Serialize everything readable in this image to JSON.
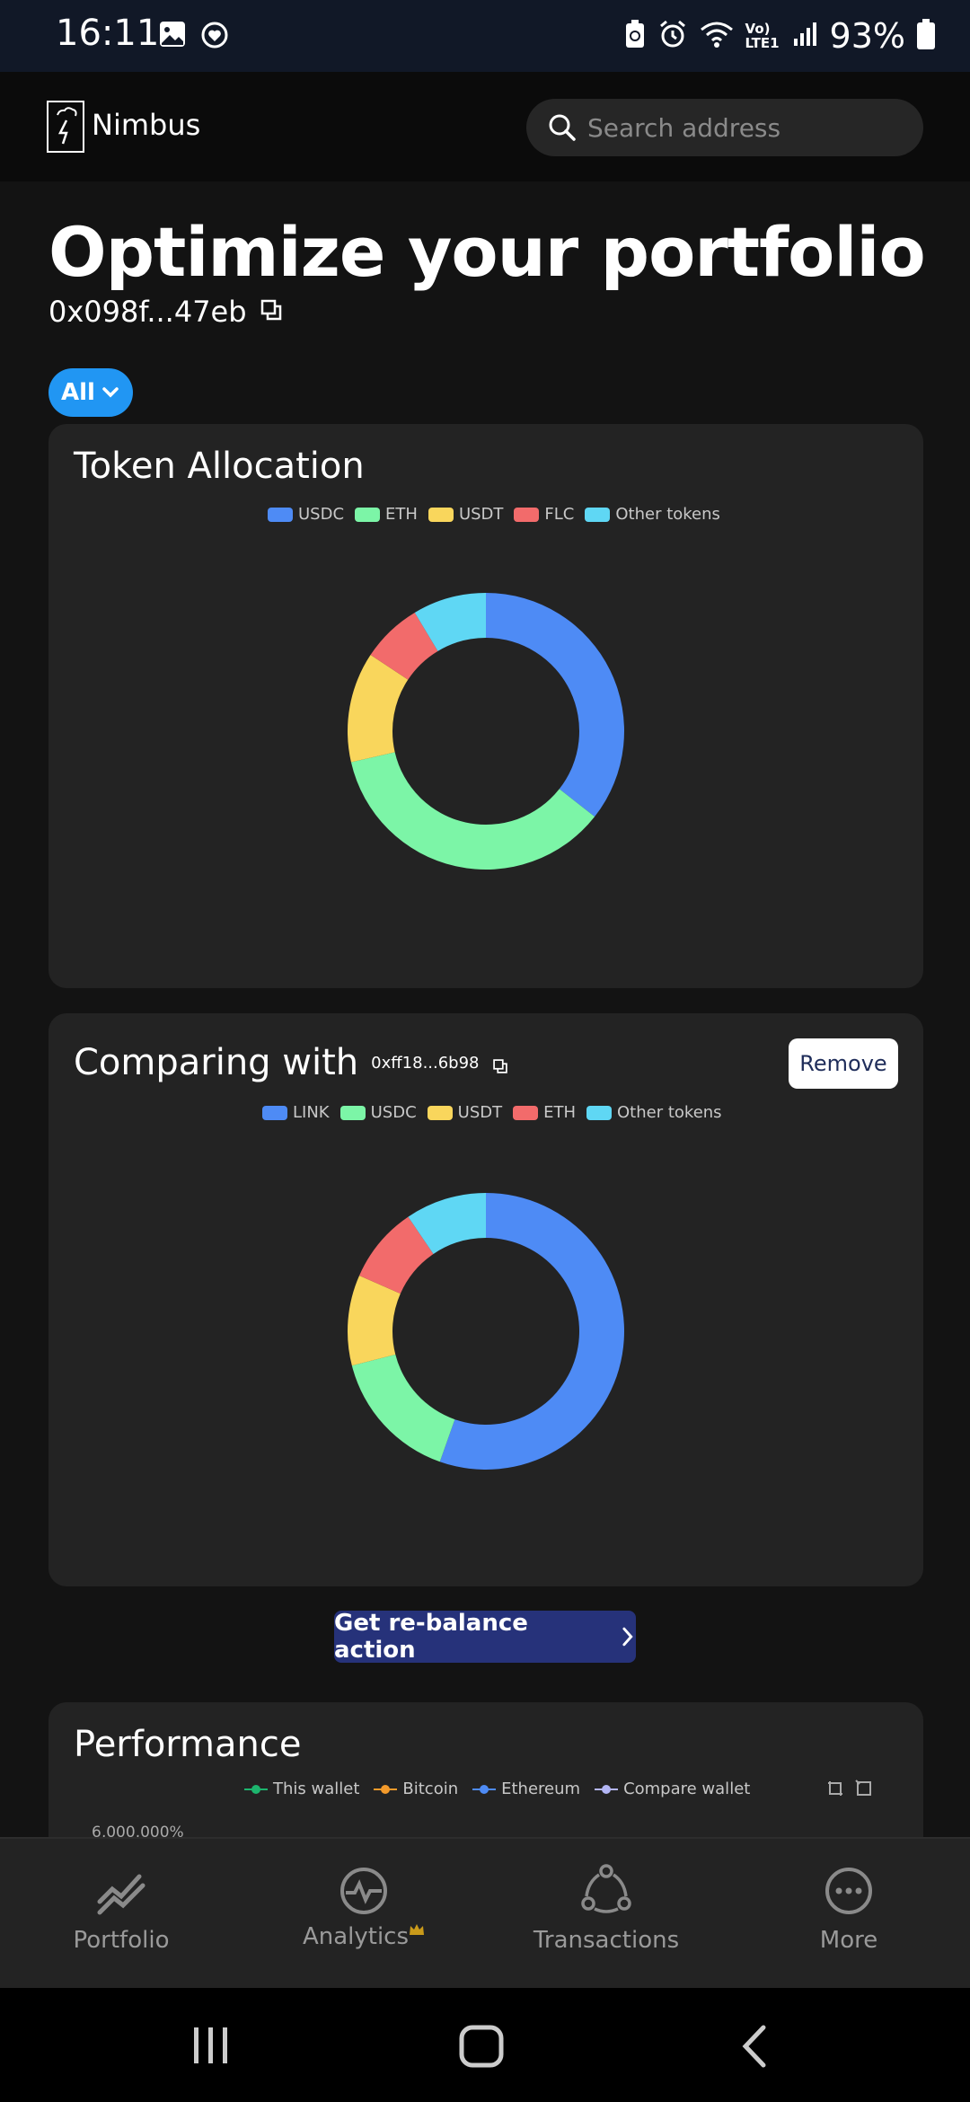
{
  "status": {
    "time": "16:11",
    "battery": "93%",
    "network_label": "Vo) LTE1"
  },
  "header": {
    "app_name": "Nimbus",
    "search_placeholder": "Search address"
  },
  "main": {
    "title": "Optimize your portfolio",
    "wallet_address": "0x098f...47eb",
    "filter_label": "All"
  },
  "allocation_card": {
    "title": "Token Allocation",
    "legend": [
      {
        "label": "USDC",
        "color": "#4e8bf5"
      },
      {
        "label": "ETH",
        "color": "#7cf5a7"
      },
      {
        "label": "USDT",
        "color": "#f9d65c"
      },
      {
        "label": "FLC",
        "color": "#f26b6b"
      },
      {
        "label": "Other tokens",
        "color": "#5fd7f4"
      }
    ]
  },
  "compare_card": {
    "title": "Comparing with",
    "address": "0xff18...6b98",
    "remove_label": "Remove",
    "legend": [
      {
        "label": "LINK",
        "color": "#4e8bf5"
      },
      {
        "label": "USDC",
        "color": "#7cf5a7"
      },
      {
        "label": "USDT",
        "color": "#f9d65c"
      },
      {
        "label": "ETH",
        "color": "#f26b6b"
      },
      {
        "label": "Other tokens",
        "color": "#5fd7f4"
      }
    ]
  },
  "rebalance_label": "Get re-balance action",
  "performance": {
    "title": "Performance",
    "legend": [
      {
        "label": "This wallet",
        "color": "#1db56e"
      },
      {
        "label": "Bitcoin",
        "color": "#f39a2b"
      },
      {
        "label": "Ethereum",
        "color": "#4e8bf5"
      },
      {
        "label": "Compare wallet",
        "color": "#b3b6f5"
      }
    ],
    "axis_top": "6,000,000%"
  },
  "bottom_nav": [
    {
      "label": "Portfolio",
      "icon": "portfolio-icon"
    },
    {
      "label": "Analytics",
      "icon": "analytics-icon"
    },
    {
      "label": "Transactions",
      "icon": "transactions-icon"
    },
    {
      "label": "More",
      "icon": "more-icon"
    }
  ],
  "chart_data": [
    {
      "type": "pie",
      "title": "Token Allocation",
      "categories": [
        "USDC",
        "ETH",
        "USDT",
        "FLC",
        "Other tokens"
      ],
      "values": [
        35.6,
        35.8,
        12.9,
        7.1,
        8.6
      ]
    },
    {
      "type": "pie",
      "title": "Comparing with",
      "categories": [
        "LINK",
        "USDC",
        "USDT",
        "ETH",
        "Other tokens"
      ],
      "values": [
        55.4,
        15.6,
        10.6,
        8.9,
        9.5
      ]
    }
  ]
}
